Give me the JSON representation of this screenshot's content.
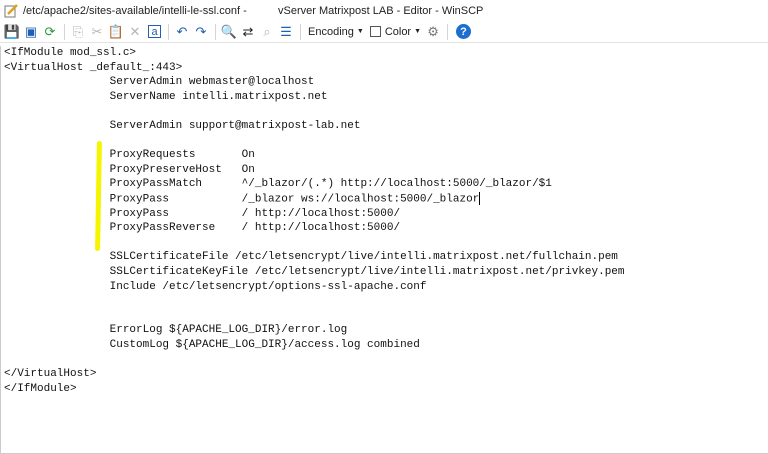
{
  "title": {
    "path": "/etc/apache2/sites-available/intelli-le-ssl.conf -",
    "app": "vServer Matrixpost LAB - Editor - WinSCP"
  },
  "toolbar": {
    "encoding_label": "Encoding",
    "color_label": "Color",
    "help_label": "?"
  },
  "lines": [
    "<IfModule mod_ssl.c>",
    "<VirtualHost _default_:443>",
    "                ServerAdmin webmaster@localhost",
    "                ServerName intelli.matrixpost.net",
    "",
    "                ServerAdmin support@matrixpost-lab.net",
    "",
    "                ProxyRequests       On",
    "                ProxyPreserveHost   On",
    "                ProxyPassMatch      ^/_blazor/(.*) http://localhost:5000/_blazor/$1",
    "                ProxyPass           /_blazor ws://localhost:5000/_blazor",
    "                ProxyPass           / http://localhost:5000/",
    "                ProxyPassReverse    / http://localhost:5000/",
    "",
    "                SSLCertificateFile /etc/letsencrypt/live/intelli.matrixpost.net/fullchain.pem",
    "                SSLCertificateKeyFile /etc/letsencrypt/live/intelli.matrixpost.net/privkey.pem",
    "                Include /etc/letsencrypt/options-ssl-apache.conf",
    "",
    "",
    "                ErrorLog ${APACHE_LOG_DIR}/error.log",
    "                CustomLog ${APACHE_LOG_DIR}/access.log combined",
    "",
    "</VirtualHost>",
    "</IfModule>"
  ]
}
